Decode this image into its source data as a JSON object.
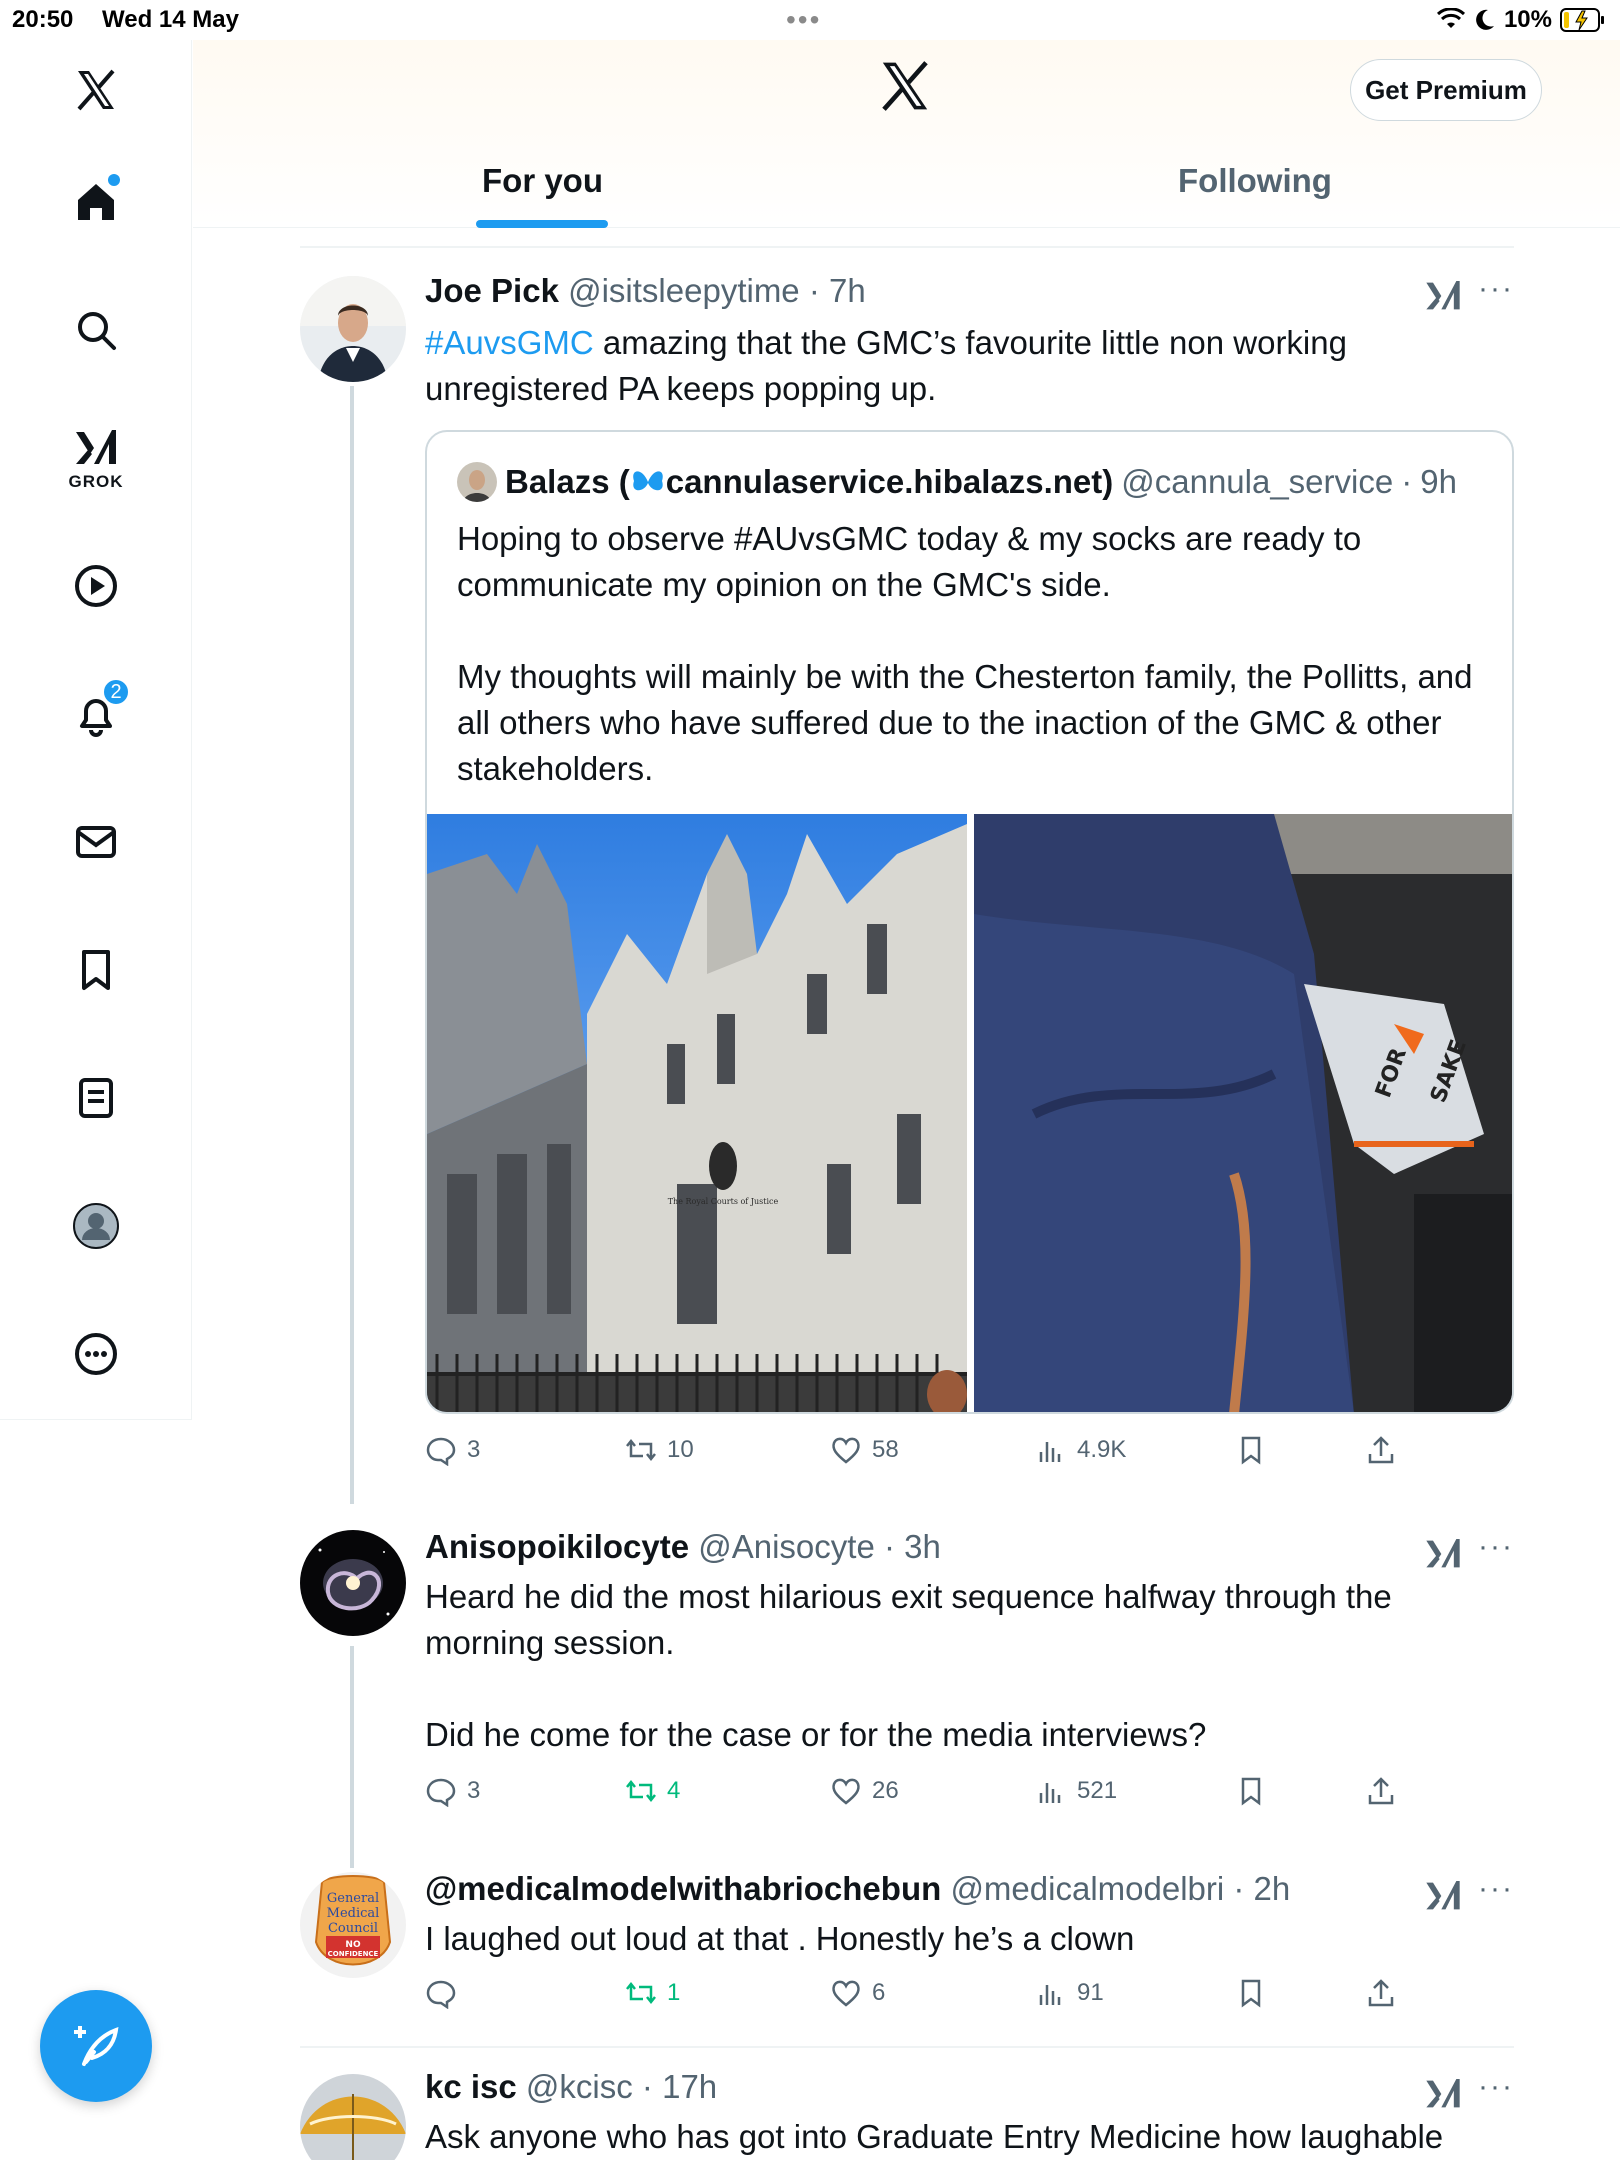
{
  "status_bar": {
    "time": "20:50",
    "date": "Wed 14 May",
    "battery": "10%"
  },
  "sidebar": {
    "grok_label": "GROK",
    "notifications_count": "2",
    "accent": "#1d9bf0"
  },
  "header": {
    "premium_label": "Get Premium",
    "tabs": [
      {
        "label": "For you",
        "active": true
      },
      {
        "label": "Following",
        "active": false
      }
    ]
  },
  "tweets": [
    {
      "name": "Joe Pick",
      "handle": "@isitsleepytime",
      "time": "7h",
      "hashtag": "#AuvsGMC",
      "text": " amazing that the GMC’s favourite little non working unregistered PA keeps popping up.",
      "quote": {
        "name_prefix": "Balazs (",
        "name_suffix": "cannulaservice.hibalazs.net)",
        "handle": "@cannula_service",
        "time": "9h",
        "para1": "Hoping to observe #AUvsGMC today & my socks are ready to communicate my opinion on the GMC's side.",
        "para2": "My thoughts will mainly be with the Chesterton family, the Pollitts, and all others who have suffered due to the inaction of the GMC & other stakeholders.",
        "sign_text": "The Royal Courts of Justice",
        "sock_text_1": "FOR",
        "sock_text_2": "SAKE"
      },
      "replies": "3",
      "reposts": "10",
      "likes": "58",
      "views": "4.9K"
    },
    {
      "name": "Anisopoikilocyte",
      "handle": "@Anisocyte",
      "time": "3h",
      "text_1": "Heard he did the most hilarious exit sequence halfway through the morning session.",
      "text_2": "Did he come for the case or for the media interviews?",
      "replies": "3",
      "reposts": "4",
      "likes": "26",
      "views": "521"
    },
    {
      "name": "@medicalmodelwithabriochebun",
      "handle": "@medicalmodelbri",
      "time": "2h",
      "text": "I laughed out loud at that . Honestly he’s a clown",
      "avatar_text_1": "General",
      "avatar_text_2": "Medical",
      "avatar_text_3": "Council",
      "avatar_text_4": "NO",
      "avatar_text_5": "CONFIDENCE",
      "replies": "",
      "reposts": "1",
      "likes": "6",
      "views": "91"
    },
    {
      "name": "kc isc",
      "handle": "@kcisc",
      "time": "17h",
      "text": "Ask anyone who has got into Graduate Entry Medicine how laughable"
    }
  ]
}
